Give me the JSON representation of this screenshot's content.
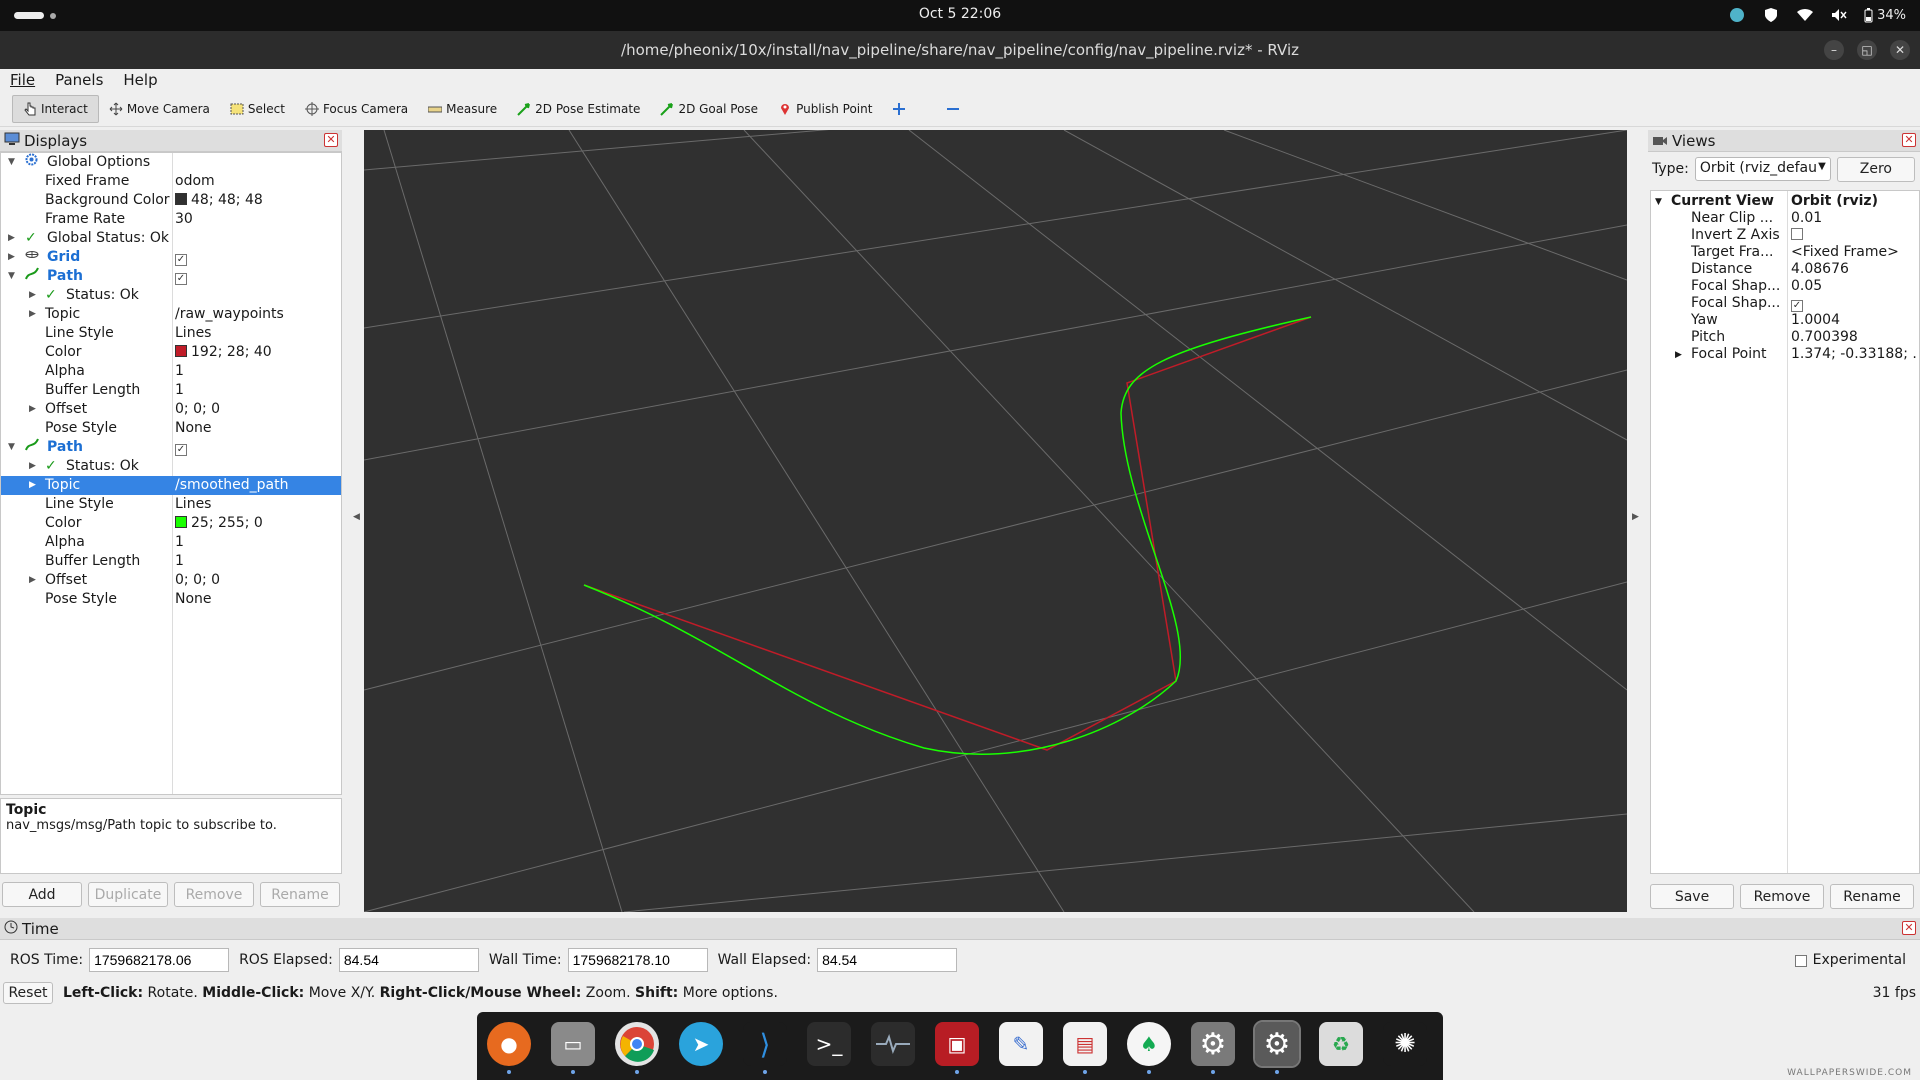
{
  "topbar": {
    "clock": "Oct 5  22:06",
    "battery": "34%"
  },
  "window": {
    "title": "/home/pheonix/10x/install/nav_pipeline/share/nav_pipeline/config/nav_pipeline.rviz* - RViz"
  },
  "menu": [
    "File",
    "Panels",
    "Help"
  ],
  "toolbar": {
    "interact": "Interact",
    "move_camera": "Move Camera",
    "select": "Select",
    "focus_camera": "Focus Camera",
    "measure": "Measure",
    "pose_estimate": "2D Pose Estimate",
    "goal_pose": "2D Goal Pose",
    "publish_point": "Publish Point"
  },
  "displays": {
    "title": "Displays",
    "rows": [
      {
        "k": "Global Options",
        "v": ""
      },
      {
        "k": "Fixed Frame",
        "v": "odom"
      },
      {
        "k": "Background Color",
        "v": "48; 48; 48"
      },
      {
        "k": "Frame Rate",
        "v": "30"
      },
      {
        "k": "Global Status: Ok",
        "v": ""
      },
      {
        "k": "Grid",
        "v": ""
      },
      {
        "k": "Path",
        "v": ""
      },
      {
        "k": "Status: Ok",
        "v": ""
      },
      {
        "k": "Topic",
        "v": "/raw_waypoints"
      },
      {
        "k": "Line Style",
        "v": "Lines"
      },
      {
        "k": "Color",
        "v": "192; 28; 40"
      },
      {
        "k": "Alpha",
        "v": "1"
      },
      {
        "k": "Buffer Length",
        "v": "1"
      },
      {
        "k": "Offset",
        "v": "0; 0; 0"
      },
      {
        "k": "Pose Style",
        "v": "None"
      },
      {
        "k": "Path",
        "v": ""
      },
      {
        "k": "Status: Ok",
        "v": ""
      },
      {
        "k": "Topic",
        "v": "/smoothed_path"
      },
      {
        "k": "Line Style",
        "v": "Lines"
      },
      {
        "k": "Color",
        "v": "25; 255; 0"
      },
      {
        "k": "Alpha",
        "v": "1"
      },
      {
        "k": "Buffer Length",
        "v": "1"
      },
      {
        "k": "Offset",
        "v": "0; 0; 0"
      },
      {
        "k": "Pose Style",
        "v": "None"
      }
    ],
    "colors": {
      "background": "#303030",
      "raw_path": "#c01c28",
      "smoothed_path": "#19ff00"
    },
    "desc_title": "Topic",
    "desc_text": "nav_msgs/msg/Path topic to subscribe to.",
    "buttons": {
      "add": "Add",
      "duplicate": "Duplicate",
      "remove": "Remove",
      "rename": "Rename"
    }
  },
  "views": {
    "title": "Views",
    "type_label": "Type:",
    "type_value": "Orbit (rviz_defau",
    "zero": "Zero",
    "rows": [
      {
        "k": "Current View",
        "v": "Orbit (rviz)"
      },
      {
        "k": "Near Clip ...",
        "v": "0.01"
      },
      {
        "k": "Invert Z Axis",
        "v": ""
      },
      {
        "k": "Target Fra...",
        "v": "<Fixed Frame>"
      },
      {
        "k": "Distance",
        "v": "4.08676"
      },
      {
        "k": "Focal Shap...",
        "v": "0.05"
      },
      {
        "k": "Focal Shap...",
        "v": ""
      },
      {
        "k": "Yaw",
        "v": "1.0004"
      },
      {
        "k": "Pitch",
        "v": "0.700398"
      },
      {
        "k": "Focal Point",
        "v": "1.374; -0.33188; ..."
      }
    ],
    "buttons": {
      "save": "Save",
      "remove": "Remove",
      "rename": "Rename"
    }
  },
  "time": {
    "title": "Time",
    "ros_time_label": "ROS Time:",
    "ros_time": "1759682178.06",
    "ros_elapsed_label": "ROS Elapsed:",
    "ros_elapsed": "84.54",
    "wall_time_label": "Wall Time:",
    "wall_time": "1759682178.10",
    "wall_elapsed_label": "Wall Elapsed:",
    "wall_elapsed": "84.54",
    "experimental": "Experimental"
  },
  "status": {
    "reset": "Reset",
    "left_click": "Left-Click:",
    "rotate": "Rotate.",
    "middle_click": "Middle-Click:",
    "move": "Move X/Y.",
    "right_click": "Right-Click/Mouse Wheel:",
    "zoom": "Zoom.",
    "shift": "Shift:",
    "more": "More options.",
    "fps": "31 fps"
  },
  "watermark": "WALLPAPERSWIDE.COM"
}
